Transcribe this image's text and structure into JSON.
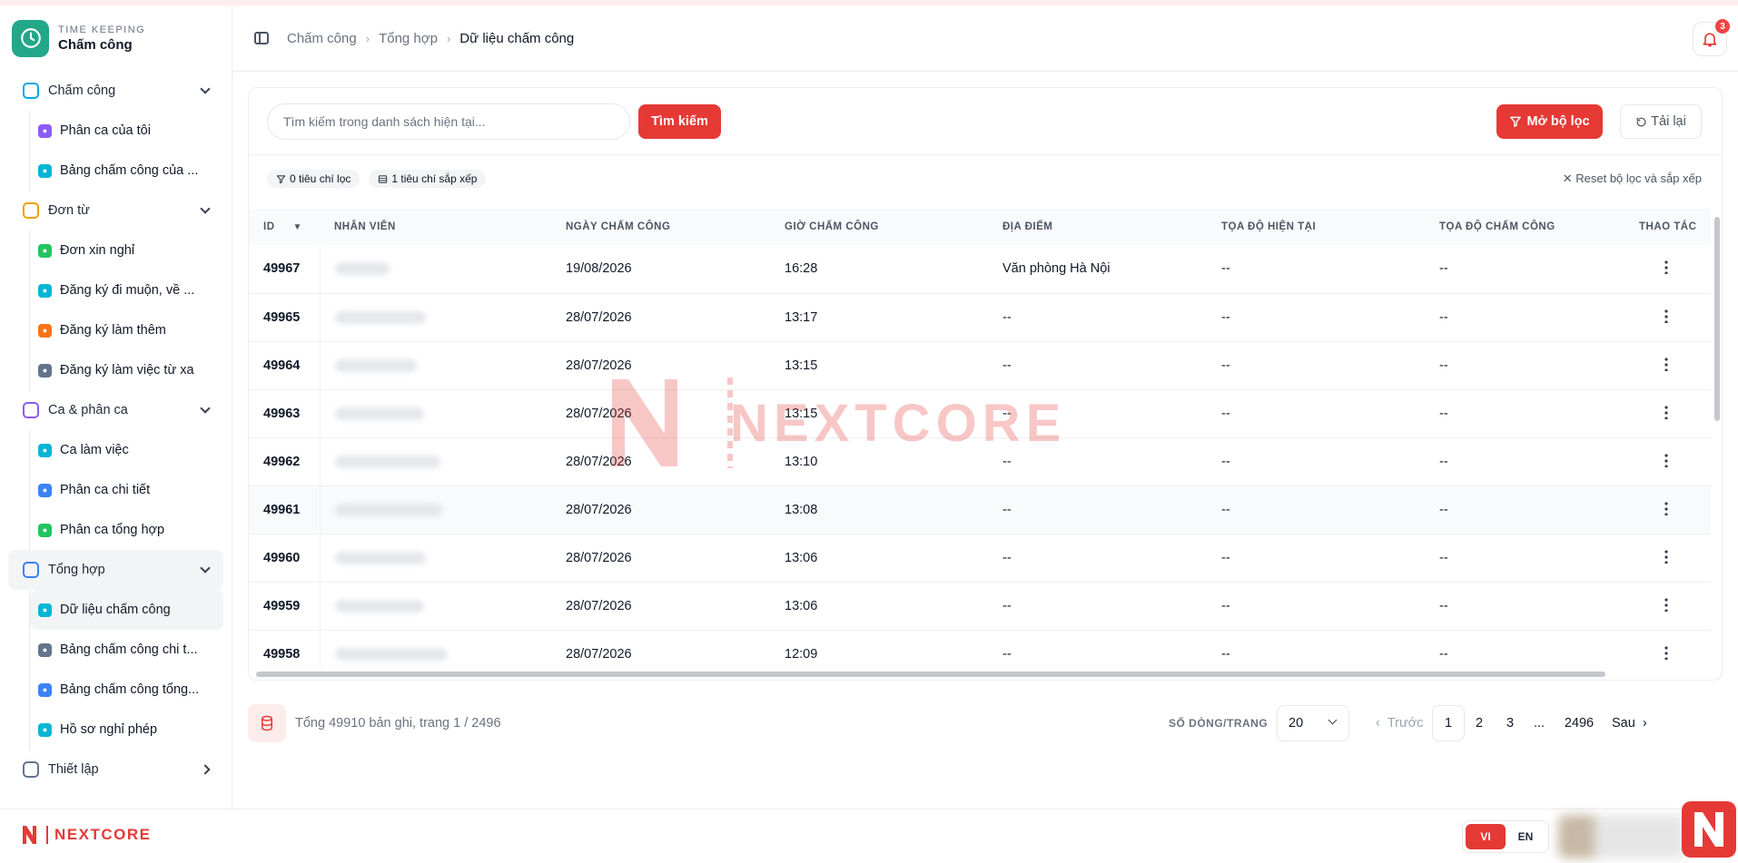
{
  "app": {
    "subtitle": "TIME KEEPING",
    "title": "Chấm công"
  },
  "sidebar": {
    "groups": [
      {
        "label": "Chấm công",
        "icon": "clock-icon",
        "color": "#0ea5e9",
        "items": [
          {
            "label": "Phân ca của tôi",
            "icon": "calendar-icon",
            "color": "#8b5cf6"
          },
          {
            "label": "Bảng chấm công của ...",
            "icon": "clock-icon",
            "color": "#06b6d4"
          }
        ]
      },
      {
        "label": "Đơn từ",
        "icon": "clipboard-icon",
        "color": "#f59e0b",
        "items": [
          {
            "label": "Đơn xin nghỉ",
            "icon": "calendar-icon",
            "color": "#22c55e"
          },
          {
            "label": "Đăng ký đi muộn, về ...",
            "icon": "clock-icon",
            "color": "#06b6d4"
          },
          {
            "label": "Đăng ký làm thêm",
            "icon": "clock-icon",
            "color": "#f97316"
          },
          {
            "label": "Đăng ký làm việc từ xa",
            "icon": "document-icon",
            "color": "#64748b"
          }
        ]
      },
      {
        "label": "Ca & phân ca",
        "icon": "calendar-icon",
        "color": "#8b5cf6",
        "items": [
          {
            "label": "Ca làm việc",
            "icon": "clock-icon",
            "color": "#06b6d4"
          },
          {
            "label": "Phân ca chi tiết",
            "icon": "users-icon",
            "color": "#3b82f6"
          },
          {
            "label": "Phân ca tổng hợp",
            "icon": "calendar-icon",
            "color": "#22c55e"
          }
        ]
      },
      {
        "label": "Tổng hợp",
        "icon": "bar-chart-icon",
        "color": "#3b82f6",
        "items": [
          {
            "label": "Dữ liệu chấm công",
            "icon": "clock-icon",
            "color": "#06b6d4"
          },
          {
            "label": "Bảng chấm công chi t...",
            "icon": "document-icon",
            "color": "#64748b"
          },
          {
            "label": "Bảng chấm công tổng...",
            "icon": "bar-chart-icon",
            "color": "#3b82f6"
          },
          {
            "label": "Hồ sơ nghỉ phép",
            "icon": "clock-icon",
            "color": "#06b6d4"
          }
        ]
      },
      {
        "label": "Thiết lập",
        "icon": "gear-icon",
        "color": "#64748b",
        "items": []
      }
    ]
  },
  "breadcrumb": [
    "Chấm công",
    "Tổng hợp",
    "Dữ liệu chấm công"
  ],
  "notifications": {
    "count": "3"
  },
  "search": {
    "placeholder": "Tìm kiếm trong danh sách hiện tại...",
    "value": "",
    "button": "Tìm kiếm"
  },
  "toolbar": {
    "filter_button": "Mở bộ lọc",
    "reload_button": "Tải lại"
  },
  "chips": {
    "filters": "0 tiêu chí lọc",
    "sorts": "1 tiêu chí sắp xếp",
    "reset": "Reset bộ lọc và sắp xếp"
  },
  "table": {
    "columns": [
      "ID",
      "Nhân viên",
      "Ngày chấm công",
      "Giờ chấm công",
      "Địa điểm",
      "Tọa độ hiện tại",
      "Tọa độ chấm công",
      "Thao tác"
    ],
    "rows": [
      {
        "id": "49967",
        "date": "19/08/2026",
        "time": "16:28",
        "location": "Văn phòng Hà Nội",
        "cur": "--",
        "chk": "--"
      },
      {
        "id": "49965",
        "date": "28/07/2026",
        "time": "13:17",
        "location": "--",
        "cur": "--",
        "chk": "--"
      },
      {
        "id": "49964",
        "date": "28/07/2026",
        "time": "13:15",
        "location": "--",
        "cur": "--",
        "chk": "--"
      },
      {
        "id": "49963",
        "date": "28/07/2026",
        "time": "13:15",
        "location": "--",
        "cur": "--",
        "chk": "--"
      },
      {
        "id": "49962",
        "date": "28/07/2026",
        "time": "13:10",
        "location": "--",
        "cur": "--",
        "chk": "--"
      },
      {
        "id": "49961",
        "date": "28/07/2026",
        "time": "13:08",
        "location": "--",
        "cur": "--",
        "chk": "--"
      },
      {
        "id": "49960",
        "date": "28/07/2026",
        "time": "13:06",
        "location": "--",
        "cur": "--",
        "chk": "--"
      },
      {
        "id": "49959",
        "date": "28/07/2026",
        "time": "13:06",
        "location": "--",
        "cur": "--",
        "chk": "--"
      },
      {
        "id": "49958",
        "date": "28/07/2026",
        "time": "12:09",
        "location": "--",
        "cur": "--",
        "chk": "--"
      }
    ]
  },
  "watermark": "NEXTCORE",
  "pagination": {
    "summary": "Tổng 49910 bản ghi, trang 1 / 2496",
    "rows_label": "SỐ DÒNG/TRANG",
    "rows_value": "20",
    "prev": "Trước",
    "pages": [
      "1",
      "2",
      "3",
      "...",
      "2496"
    ],
    "next": "Sau"
  },
  "footer": {
    "brand": "NEXTCORE",
    "lang_vi": "VI",
    "lang_en": "EN"
  },
  "colors": {
    "accent": "#e53935",
    "brand_green": "#22a788"
  }
}
